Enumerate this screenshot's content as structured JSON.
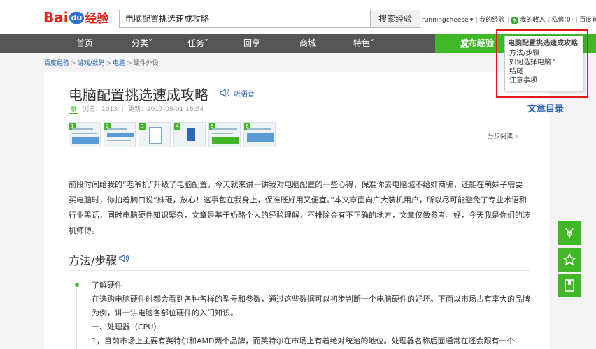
{
  "header": {
    "logo_bai": "Bai",
    "logo_du": "du",
    "logo_jingyan": "经验",
    "search_value": "电脑配置挑选速成攻略",
    "search_button": "搜索经验",
    "username": "runningcheese",
    "my_jingyan": "我的经验",
    "my_income": "我的收入",
    "message": "私信(0)",
    "homepage": "百度首页"
  },
  "nav": {
    "items": [
      "首页",
      "分类",
      "任务",
      "回享",
      "商城",
      "特色"
    ],
    "publish": "发布经验"
  },
  "breadcrumb": [
    "百度经验",
    "游戏/数码",
    "电脑",
    "硬件外设"
  ],
  "article": {
    "title": "电脑配置挑选速成攻略",
    "listen": "听语音",
    "original_badge": "原",
    "views": "浏览：1013",
    "updated": "更新：2017-08-01 16:54",
    "step_read": "分步阅读",
    "intro": "前段时间给我的“老爷机”升级了电脑配置，今天就来讲一讲我对电脑配置的一些心得，保准你去电脑城不给奸商骗，还能在萌妹子需要买电脑时，你拍着胸口说“妹砸，放心！这事包在我身上，保准既好用又便宜。”本文章面向广大装机用户，所以尽可能避免了专业术语和行业黑话，同时电脑硬件知识繁杂，文章是基于奶酪个人的经验理解，不排除会有不正确的地方，文章仅做参考。好，今天我是你们的装机师傅。",
    "section_title": "方法/步骤",
    "step1_title": "了解硬件",
    "step1_p1": "在选购电脑硬件时都会看到各种各样的型号和参数，通过这些数据可以初步判断一个电脑硬件的好坏。下面以市场占有率大的品牌为例，讲一讲电脑各部位硬件的入门知识。",
    "step1_p2": "一、处理器（CPU）",
    "step1_p3": "1，目前市场上主要有英特尔和AMD两个品牌，而英特尔在市场上有着绝对统治的地位。处理器名称后面通常在还会跟有一个",
    "thumbs": [
      "1",
      "2",
      "3",
      "4",
      "5",
      "6"
    ]
  },
  "toc": {
    "heading": "电脑配置挑选速成攻略",
    "items": [
      "方法/步骤",
      "如何选择电脑？",
      "结尾",
      "注意事项"
    ],
    "link": "文章目录"
  },
  "side_buttons": [
    "share-icon",
    "star-icon",
    "bookmark-icon"
  ],
  "colors": {
    "green": "#41b728",
    "nav": "#565656",
    "link": "#2d64b3",
    "red": "#e21a1a"
  }
}
